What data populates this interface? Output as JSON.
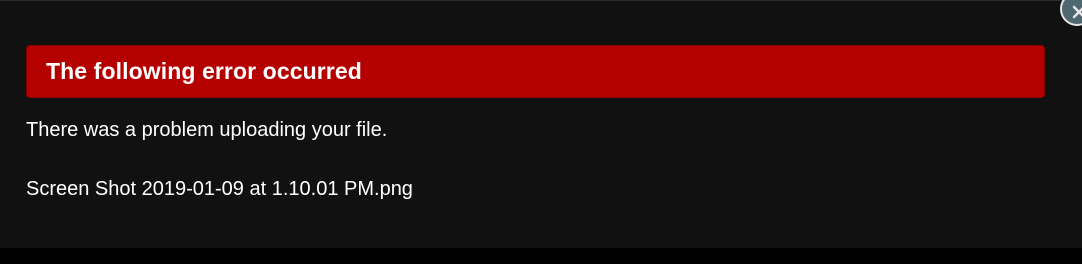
{
  "dialog": {
    "error_title": "The following error occurred",
    "message": "There was a problem uploading your file.",
    "filename": "Screen Shot 2019-01-09 at 1.10.01 PM.png",
    "close_icon": "close-icon"
  },
  "colors": {
    "banner": "#b50000",
    "background": "#111111",
    "text": "#ffffff",
    "close_button": "#4f6770"
  }
}
